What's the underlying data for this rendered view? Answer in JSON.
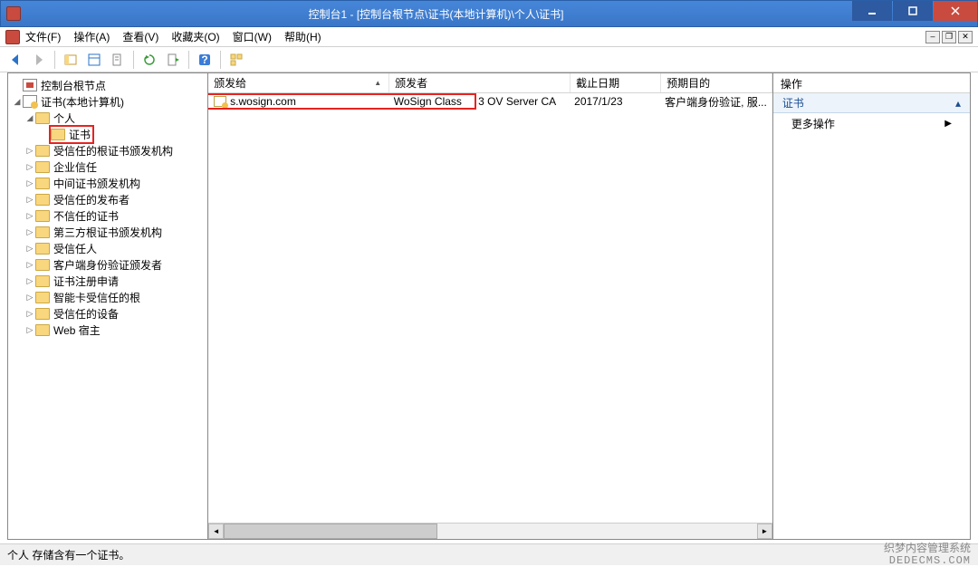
{
  "window": {
    "title": "控制台1 - [控制台根节点\\证书(本地计算机)\\个人\\证书]"
  },
  "menu": {
    "file": "文件(F)",
    "action": "操作(A)",
    "view": "查看(V)",
    "favorites": "收藏夹(O)",
    "window": "窗口(W)",
    "help": "帮助(H)"
  },
  "tree": {
    "root": "控制台根节点",
    "cert_store": "证书(本地计算机)",
    "personal": "个人",
    "certificates": "证书",
    "items": [
      "受信任的根证书颁发机构",
      "企业信任",
      "中间证书颁发机构",
      "受信任的发布者",
      "不信任的证书",
      "第三方根证书颁发机构",
      "受信任人",
      "客户端身份验证颁发者",
      "证书注册申请",
      "智能卡受信任的根",
      "受信任的设备",
      "Web 宿主"
    ]
  },
  "list": {
    "columns": {
      "issued_to": "颁发给",
      "issued_by": "颁发者",
      "expiry": "截止日期",
      "purpose": "预期目的"
    },
    "rows": [
      {
        "issued_to": "s.wosign.com",
        "issued_by": "WoSign Class 3 OV Server CA",
        "expiry": "2017/1/23",
        "purpose": "客户端身份验证, 服..."
      }
    ]
  },
  "actions": {
    "header": "操作",
    "title": "证书",
    "more": "更多操作"
  },
  "status": {
    "text": "个人 存储含有一个证书。"
  },
  "watermark": {
    "line1": "织梦内容管理系统",
    "line2": "DEDECMS.COM"
  }
}
